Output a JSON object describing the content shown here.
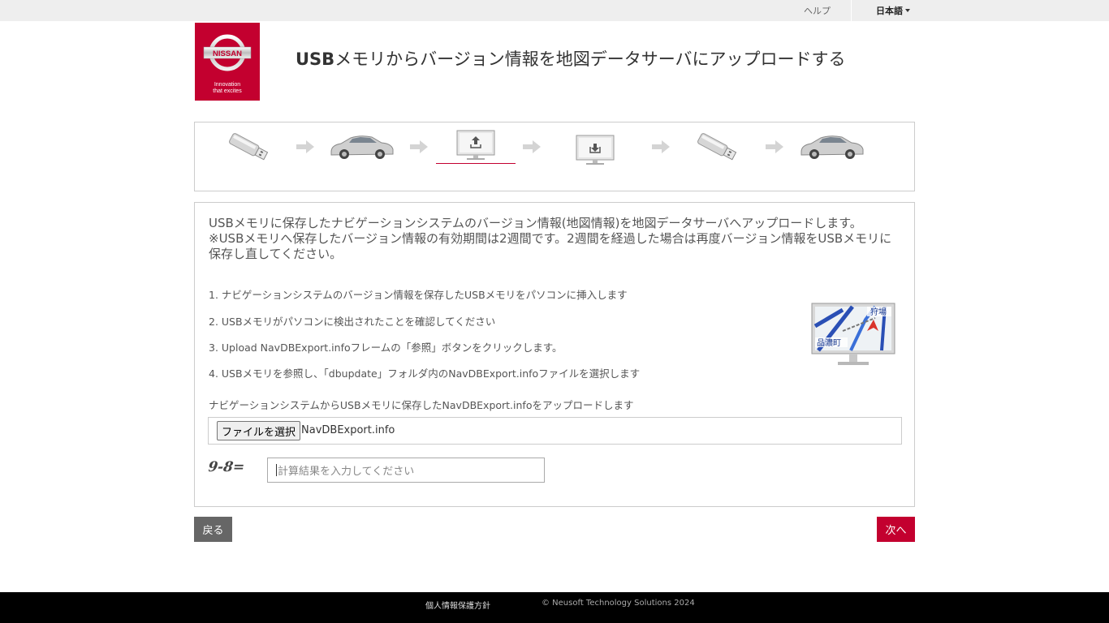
{
  "topbar": {
    "help": "ヘルプ",
    "language": "日本語"
  },
  "brand": {
    "name": "NISSAN",
    "tagline_1": "Innovation",
    "tagline_2": "that excites",
    "color": "#c3002f"
  },
  "header": {
    "title_prefix": "USB",
    "title_rest": "メモリからバージョン情報を地図データサーバにアップロードする"
  },
  "steps": {
    "items": [
      "usb-stick-icon",
      "car-icon",
      "monitor-upload-icon",
      "monitor-download-icon",
      "usb-stick-icon",
      "car-icon"
    ],
    "active_index": 2
  },
  "content": {
    "intro_1": "USBメモリに保存したナビゲーションシステムのバージョン情報(地図情報)を地図データサーバへアップロードします。",
    "intro_2": "※USBメモリへ保存したバージョン情報の有効期間は2週間です。2週間を経過した場合は再度バージョン情報をUSBメモリに保存し直してください。",
    "step1": "1. ナビゲーションシステムのバージョン情報を保存したUSBメモリをパソコンに挿入します",
    "step2": "2. USBメモリがパソコンに検出されたことを確認してください",
    "step3": "3. Upload NavDBExport.infoフレームの「参照」ボタンをクリックします。",
    "step4": "4. USBメモリを参照し、「dbupdate」フォルダ内のNavDBExport.infoファイルを選択します",
    "map_labels": [
      "狩場",
      "品濃町"
    ],
    "upload_label": "ナビゲーションシステムからUSBメモリに保存したNavDBExport.infoをアップロードします",
    "file_button": "ファイルを選択",
    "file_name": "NavDBExport.info",
    "captcha_text": "9-8=",
    "captcha_placeholder": "計算結果を入力してください"
  },
  "nav": {
    "back": "戻る",
    "next": "次へ"
  },
  "footer": {
    "privacy": "個人情報保護方針",
    "copyright": "© Neusoft Technology Solutions 2024"
  }
}
